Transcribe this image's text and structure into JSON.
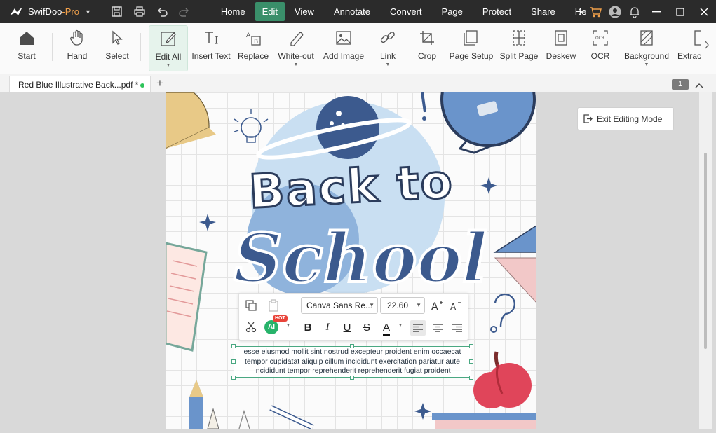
{
  "app": {
    "name": "SwifDoo",
    "edition": "-Pro"
  },
  "menu": [
    "Home",
    "Edit",
    "View",
    "Annotate",
    "Convert",
    "Page",
    "Protect",
    "Share",
    "He"
  ],
  "ribbon": {
    "start": "Start",
    "hand": "Hand",
    "select": "Select",
    "edit_all": "Edit All",
    "insert_text": "Insert Text",
    "replace": "Replace",
    "white_out": "White-out",
    "add_image": "Add Image",
    "link": "Link",
    "crop": "Crop",
    "page_setup": "Page Setup",
    "split_page": "Split Page",
    "deskew": "Deskew",
    "ocr": "OCR",
    "background": "Background",
    "extract": "Extrac"
  },
  "tab": {
    "title": "Red Blue Illustrative Back...pdf *",
    "page_number": "1"
  },
  "exit_editing": "Exit Editing Mode",
  "text_toolbar": {
    "font": "Canva Sans Re...",
    "size": "22.60",
    "ai_label": "AI",
    "hot_badge": "HOT"
  },
  "textbox_lines": [
    "esse eiusmod mollit sint nostrud excepteur proident enim occaecat",
    "tempor cupidatat aliquip cillum incididunt exercitation pariatur aute",
    "incididunt tempor reprehenderit reprehenderit fugiat proident"
  ],
  "poster": {
    "line1": "Back to",
    "line2": "School"
  },
  "colors": {
    "accent": "#3a8f6a",
    "titlebar": "#2b2b2b",
    "navy": "#3c5a8e"
  }
}
